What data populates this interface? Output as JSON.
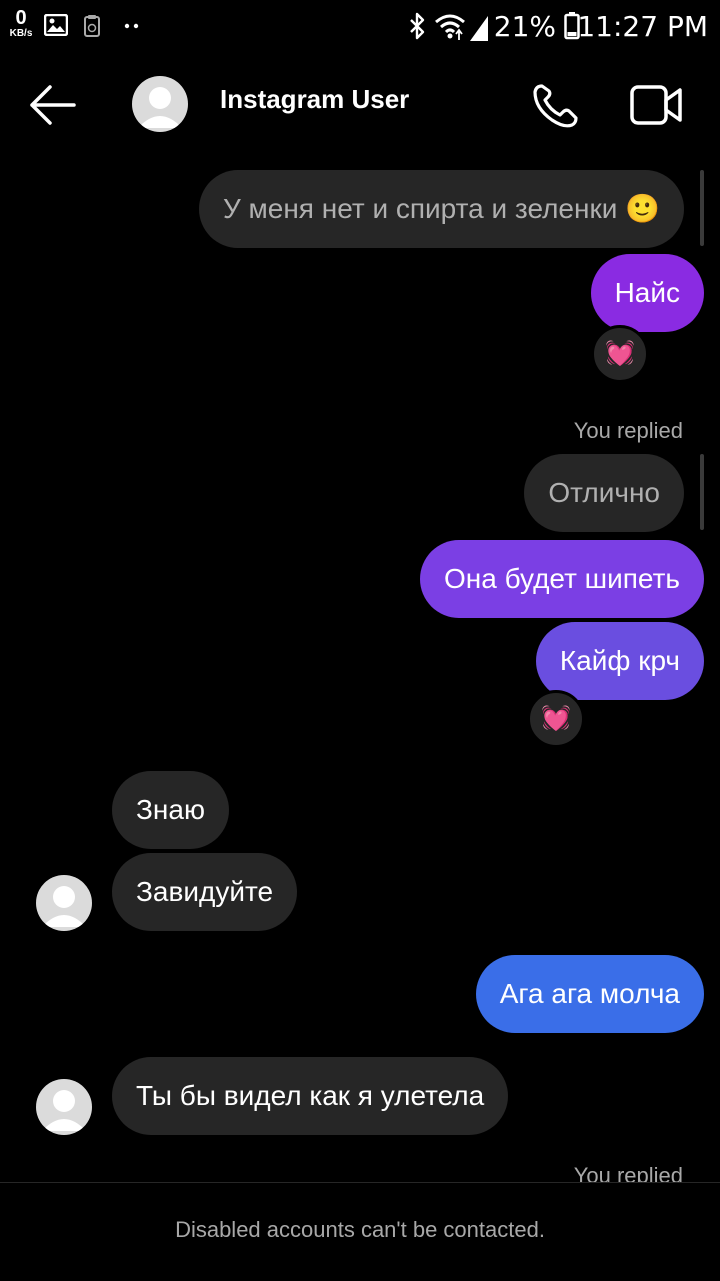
{
  "status_bar": {
    "net_speed": "0",
    "net_unit": "KB/s",
    "battery_percent": "21%",
    "time": "11:27 PM"
  },
  "header": {
    "name": "Instagram User",
    "icons": [
      "back-arrow-icon",
      "phone-icon",
      "video-camera-icon"
    ]
  },
  "messages": {
    "m1_reply_text": "У меня нет и спирта и зеленки 🙂",
    "m2_text": "Найс",
    "m2_reaction": "💓",
    "you_replied_1": "You replied",
    "m3_reply_text": "Отлично",
    "m4_text": "Она будет шипеть",
    "m5_text": "Кайф крч",
    "m5_reaction": "💓",
    "m6_text": "Знаю",
    "m7_text": "Завидуйте",
    "m8_text": "Ага ага молча",
    "m9_text": "Ты бы видел как я улетела",
    "you_replied_2": "You replied"
  },
  "colors": {
    "sent_purple": "#8a2be2",
    "sent_violet": "#7b3fe4",
    "sent_indigo": "#6a4ee0",
    "sent_blue": "#3a6ee8",
    "received_bg": "#262626"
  },
  "footer": {
    "text": "Disabled accounts can't be contacted."
  }
}
